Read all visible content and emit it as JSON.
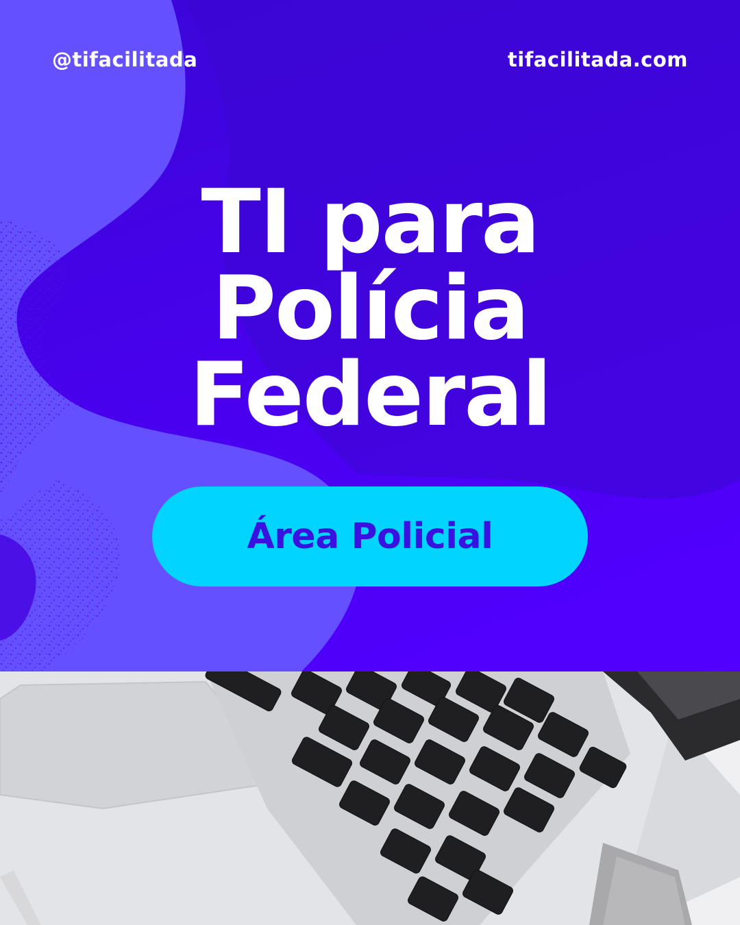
{
  "header": {
    "handle": "@tifacilitada",
    "website": "tifacilitada.com"
  },
  "headline": {
    "line1": "TI para",
    "line2": "Polícia",
    "line3": "Federal"
  },
  "badge": {
    "label": "Área Policial"
  },
  "photo": {
    "subject": "laptop-keyboard-image"
  },
  "colors": {
    "background_purple": "#4a00f0",
    "blob_lavender": "#6450ff",
    "badge_cyan": "#00d4ff",
    "badge_text": "#3a12e0",
    "text_white": "#ffffff"
  }
}
